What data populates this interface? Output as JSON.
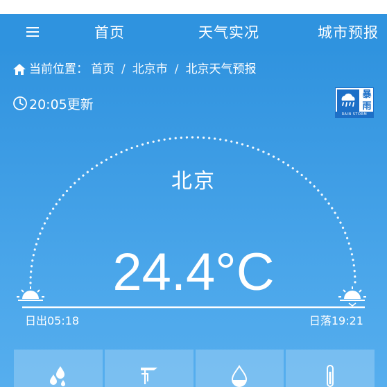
{
  "nav": {
    "home": "首页",
    "live": "天气实况",
    "forecast": "城市预报"
  },
  "breadcrumb": {
    "prefix": "当前位置：",
    "items": [
      "首页",
      "北京市",
      "北京天气预报"
    ],
    "separator": "/"
  },
  "update_time": "20:05更新",
  "warning": {
    "title": "暴雨",
    "subtitle": "RAIN STORM",
    "icon": "rainstorm-warning-icon",
    "color": "#1d6fc7"
  },
  "city": "北京",
  "temperature": "24.4°C",
  "sunrise": "日出05:18",
  "sunset": "日落19:21",
  "cards": [
    {
      "icon": "humidity-drops-icon"
    },
    {
      "icon": "wind-vane-icon"
    },
    {
      "icon": "precipitation-drop-icon"
    },
    {
      "icon": "thermometer-icon"
    }
  ],
  "colors": {
    "background": "#3a9ae3",
    "navbar": "#2f93df"
  }
}
